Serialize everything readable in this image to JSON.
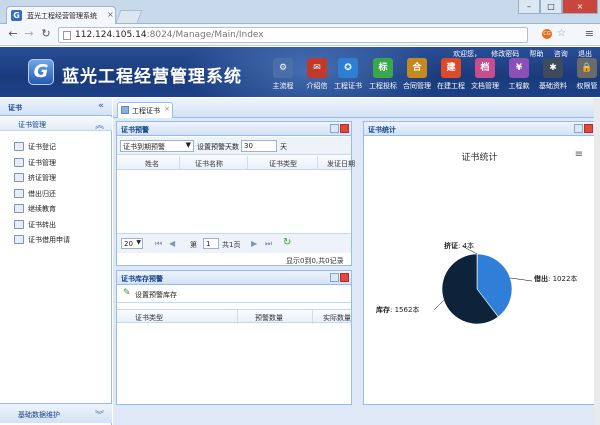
{
  "browser": {
    "tab_title": "蓝光工程经营管理系统",
    "url_host": "112.124.105.14",
    "url_path": ":8024/Manage/Main/Index",
    "ext_icon": "CG"
  },
  "header": {
    "logo_letter": "G",
    "system_title": "蓝光工程经营管理系统",
    "top_links": [
      "欢迎您，",
      "修改密码",
      "帮助",
      "咨询",
      "退出"
    ],
    "nav": [
      {
        "label": "主流程",
        "icon": "gear-icon",
        "glyph": "⚙",
        "color": "#4a6fa8"
      },
      {
        "label": "介绍信",
        "icon": "envelope-icon",
        "glyph": "✉",
        "color": "#c0392b"
      },
      {
        "label": "工程证书",
        "icon": "certificate-icon",
        "glyph": "✪",
        "color": "#2e7fd1"
      },
      {
        "label": "工程投标",
        "icon": "bid-icon",
        "glyph": "标",
        "color": "#3aa84a"
      },
      {
        "label": "合同管理",
        "icon": "contract-icon",
        "glyph": "合",
        "color": "#c58a1e"
      },
      {
        "label": "在建工程",
        "icon": "construction-icon",
        "glyph": "建",
        "color": "#d94b2b"
      },
      {
        "label": "文档管理",
        "icon": "document-icon",
        "glyph": "档",
        "color": "#c84c8e"
      },
      {
        "label": "工程款",
        "icon": "payment-icon",
        "glyph": "¥",
        "color": "#8b4fb8"
      },
      {
        "label": "基础资料",
        "icon": "tools-icon",
        "glyph": "✱",
        "color": "#3d4b5e"
      },
      {
        "label": "权限管",
        "icon": "lock-icon",
        "glyph": "🔒",
        "color": "#6a6a6a"
      }
    ]
  },
  "sidebar": {
    "title": "证书",
    "section": "证书管理",
    "items": [
      {
        "label": "证书登记",
        "icon": "book-icon"
      },
      {
        "label": "证书管理",
        "icon": "book-open-icon"
      },
      {
        "label": "挤证管理",
        "icon": "list-icon"
      },
      {
        "label": "借出归还",
        "icon": "exchange-icon"
      },
      {
        "label": "继续教育",
        "icon": "education-icon"
      },
      {
        "label": "证书转出",
        "icon": "transfer-icon"
      },
      {
        "label": "证书借用申请",
        "icon": "apply-icon"
      }
    ],
    "footer": "基础数据维护"
  },
  "main": {
    "tab_label": "工程证书",
    "warning_panel": {
      "title": "证书预警",
      "select_value": "证书到期预警",
      "days_label": "设置预警天数",
      "days_value": "30",
      "days_unit": "天",
      "columns": [
        "姓名",
        "证书名称",
        "证书类型",
        "发证日期"
      ],
      "page_size": "20",
      "page_prefix": "第",
      "page_value": "1",
      "page_total": "共1页",
      "page_info": "显示0到0,共0记录"
    },
    "stock_panel": {
      "title": "证书库存预警",
      "action": "设置预警库存",
      "columns": [
        "证书类型",
        "预警数量",
        "实际数量"
      ]
    },
    "stats_panel": {
      "title": "证书统计"
    }
  },
  "chart_data": {
    "type": "pie",
    "title": "证书统计",
    "series": [
      {
        "name": "挤证",
        "value": 4,
        "color": "#7cb5ec"
      },
      {
        "name": "借出",
        "value": 1022,
        "color": "#2f7ed8"
      },
      {
        "name": "库存",
        "value": 1562,
        "color": "#0d233a"
      }
    ],
    "unit": "本"
  }
}
